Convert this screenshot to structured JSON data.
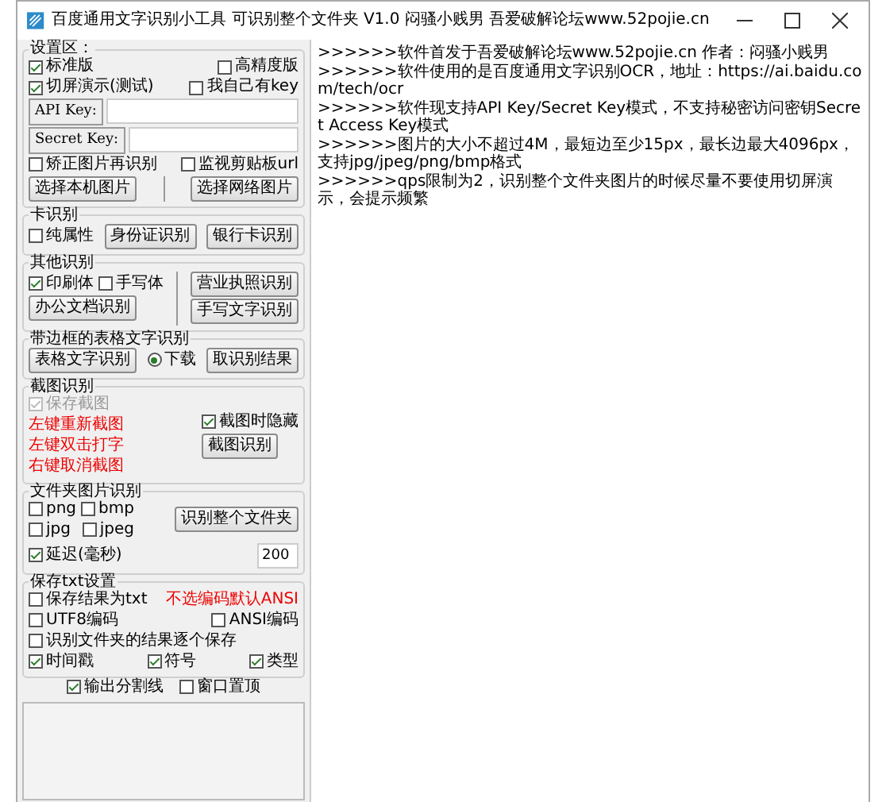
{
  "window": {
    "title": "百度通用文字识别小工具 可识别整个文件夹 V1.0  闷骚小贱男    吾爱破解论坛www.52pojie.cn"
  },
  "panel": {
    "groups": [
      {
        "title": "设置区：",
        "rows": [
          [
            {
              "kind": "check",
              "label": "标准版",
              "checked": true,
              "disabled": false
            },
            {
              "kind": "check",
              "label": "高精度版",
              "checked": false,
              "disabled": false
            }
          ],
          [
            {
              "kind": "check",
              "label": "切屏演示(测试)",
              "checked": true,
              "disabled": false
            },
            {
              "kind": "check",
              "label": "我自己有key",
              "checked": false,
              "disabled": false
            }
          ],
          [
            {
              "kind": "field",
              "label": "API Key:"
            }
          ],
          [
            {
              "kind": "field",
              "label": "Secret Key:"
            }
          ],
          [
            {
              "kind": "check",
              "label": "矫正图片再识别",
              "checked": false,
              "disabled": false
            },
            {
              "kind": "check",
              "label": "监视剪贴板url",
              "checked": false,
              "disabled": false
            }
          ],
          [
            {
              "kind": "button",
              "label": "选择本机图片"
            },
            {
              "kind": "divider"
            },
            {
              "kind": "button",
              "label": "选择网络图片"
            }
          ]
        ]
      },
      {
        "title": "卡识别",
        "rows": [
          [
            {
              "kind": "check",
              "label": "纯属性",
              "checked": false,
              "disabled": false
            },
            {
              "kind": "button",
              "label": "身份证识别"
            },
            {
              "kind": "button",
              "label": "银行卡识别"
            }
          ]
        ]
      },
      {
        "title": "其他识别",
        "rows": [
          [
            {
              "kind": "column",
              "rows": [
                [
                  {
                    "kind": "check",
                    "label": "印刷体",
                    "checked": true,
                    "disabled": false
                  },
                  {
                    "kind": "check",
                    "label": "手写体",
                    "checked": false,
                    "disabled": false
                  }
                ],
                [
                  {
                    "kind": "button",
                    "label": "办公文档识别"
                  }
                ]
              ]
            },
            {
              "kind": "divider"
            },
            {
              "kind": "column",
              "rows": [
                [
                  {
                    "kind": "button",
                    "label": "营业执照识别"
                  }
                ],
                [
                  {
                    "kind": "button",
                    "label": "手写文字识别"
                  }
                ]
              ]
            }
          ]
        ]
      },
      {
        "title": "带边框的表格文字识别",
        "rows": [
          [
            {
              "kind": "button",
              "label": "表格文字识别"
            },
            {
              "kind": "radio",
              "label": "下载",
              "selected": true
            },
            {
              "kind": "button",
              "label": "取识别结果"
            }
          ]
        ]
      },
      {
        "title": "截图识别",
        "rows": [
          [
            {
              "kind": "column",
              "rows": [
                [
                  {
                    "kind": "check",
                    "label": "保存截图",
                    "checked": true,
                    "disabled": true
                  }
                ],
                [
                  {
                    "kind": "note",
                    "label": "左键重新截图"
                  }
                ],
                [
                  {
                    "kind": "note",
                    "label": "左键双击打字"
                  }
                ],
                [
                  {
                    "kind": "note",
                    "label": "右键取消截图"
                  }
                ]
              ]
            },
            {
              "kind": "column",
              "rows": [
                [
                  {
                    "kind": "check",
                    "label": "截图时隐藏",
                    "checked": true,
                    "disabled": false
                  }
                ],
                [
                  {
                    "kind": "button",
                    "label": "截图识别"
                  }
                ]
              ]
            }
          ]
        ]
      },
      {
        "title": "文件夹图片识别",
        "rows": [
          [
            {
              "kind": "column",
              "rows": [
                [
                  {
                    "kind": "check",
                    "label": "png",
                    "checked": false,
                    "disabled": false
                  },
                  {
                    "kind": "check",
                    "label": "bmp",
                    "checked": false,
                    "disabled": false
                  }
                ],
                [
                  {
                    "kind": "check",
                    "label": "jpg",
                    "checked": false,
                    "disabled": false
                  },
                  {
                    "kind": "check",
                    "label": "jpeg",
                    "checked": false,
                    "disabled": false
                  }
                ]
              ]
            },
            {
              "kind": "column",
              "rows": [
                [
                  {
                    "kind": "button",
                    "label": "识别整个文件夹"
                  }
                ]
              ]
            }
          ],
          [
            {
              "kind": "check",
              "label": "延迟(毫秒)",
              "checked": true,
              "disabled": false
            },
            {
              "kind": "field",
              "value": "200"
            }
          ]
        ]
      },
      {
        "title": "保存txt设置",
        "rows": [
          [
            {
              "kind": "check",
              "label": "保存结果为txt",
              "checked": false,
              "disabled": false
            },
            {
              "kind": "note",
              "label": "不选编码默认ANSI"
            }
          ],
          [
            {
              "kind": "check",
              "label": "UTF8编码",
              "checked": false,
              "disabled": false
            },
            {
              "kind": "check",
              "label": "ANSI编码",
              "checked": false,
              "disabled": false
            }
          ],
          [
            {
              "kind": "check",
              "label": "识别文件夹的结果逐个保存",
              "checked": false,
              "disabled": false
            }
          ],
          [
            {
              "kind": "check",
              "label": "时间戳",
              "checked": true,
              "disabled": false
            },
            {
              "kind": "check",
              "label": "符号",
              "checked": true,
              "disabled": false
            },
            {
              "kind": "check",
              "label": "类型",
              "checked": true,
              "disabled": false
            }
          ]
        ]
      }
    ],
    "footer": [
      {
        "kind": "check",
        "label": "输出分割线",
        "checked": true,
        "disabled": false
      },
      {
        "kind": "check",
        "label": "窗口置顶",
        "checked": false,
        "disabled": false
      }
    ]
  },
  "log": {
    "lines": [
      ">>>>>>软件首发于吾爱破解论坛www.52pojie.cn  作者：闷骚小贱男",
      ">>>>>>软件使用的是百度通用文字识别OCR，地址：https://ai.baidu.com/tech/ocr",
      ">>>>>>软件现支持API Key/Secret Key模式，不支持秘密访问密钥Secret Access Key模式",
      ">>>>>>图片的大小不超过4M，最短边至少15px，最长边最大4096px，支持jpg/jpeg/png/bmp格式",
      ">>>>>>qps限制为2，识别整个文件夹图片的时候尽量不要使用切屏演示，会提示频繁"
    ]
  }
}
